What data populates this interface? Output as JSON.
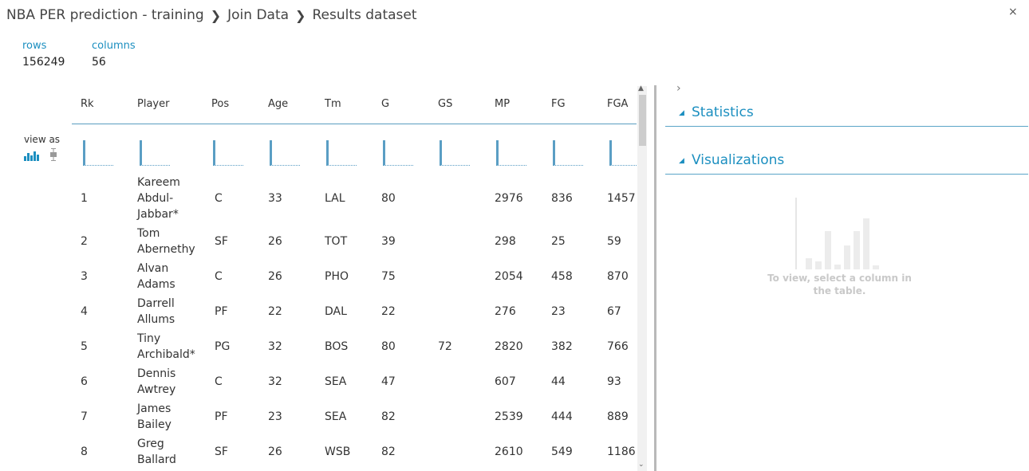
{
  "breadcrumb": {
    "items": [
      "NBA PER prediction - training",
      "Join Data",
      "Results dataset"
    ],
    "separator": "❯"
  },
  "close_label": "×",
  "meta": {
    "rows_label": "rows",
    "rows_value": "156249",
    "columns_label": "columns",
    "columns_value": "56"
  },
  "view_as_label": "view as",
  "table": {
    "columns": [
      "Rk",
      "Player",
      "Pos",
      "Age",
      "Tm",
      "G",
      "GS",
      "MP",
      "FG",
      "FGA"
    ],
    "rows": [
      {
        "Rk": "1",
        "Player": [
          "Kareem",
          "Abdul-",
          "Jabbar*"
        ],
        "Pos": "C",
        "Age": "33",
        "Tm": "LAL",
        "G": "80",
        "GS": "",
        "MP": "2976",
        "FG": "836",
        "FGA": "1457"
      },
      {
        "Rk": "2",
        "Player": [
          "Tom",
          "Abernethy"
        ],
        "Pos": "SF",
        "Age": "26",
        "Tm": "TOT",
        "G": "39",
        "GS": "",
        "MP": "298",
        "FG": "25",
        "FGA": "59"
      },
      {
        "Rk": "3",
        "Player": [
          "Alvan",
          "Adams"
        ],
        "Pos": "C",
        "Age": "26",
        "Tm": "PHO",
        "G": "75",
        "GS": "",
        "MP": "2054",
        "FG": "458",
        "FGA": "870"
      },
      {
        "Rk": "4",
        "Player": [
          "Darrell",
          "Allums"
        ],
        "Pos": "PF",
        "Age": "22",
        "Tm": "DAL",
        "G": "22",
        "GS": "",
        "MP": "276",
        "FG": "23",
        "FGA": "67"
      },
      {
        "Rk": "5",
        "Player": [
          "Tiny",
          "Archibald*"
        ],
        "Pos": "PG",
        "Age": "32",
        "Tm": "BOS",
        "G": "80",
        "GS": "72",
        "MP": "2820",
        "FG": "382",
        "FGA": "766"
      },
      {
        "Rk": "6",
        "Player": [
          "Dennis",
          "Awtrey"
        ],
        "Pos": "C",
        "Age": "32",
        "Tm": "SEA",
        "G": "47",
        "GS": "",
        "MP": "607",
        "FG": "44",
        "FGA": "93"
      },
      {
        "Rk": "7",
        "Player": [
          "James",
          "Bailey"
        ],
        "Pos": "PF",
        "Age": "23",
        "Tm": "SEA",
        "G": "82",
        "GS": "",
        "MP": "2539",
        "FG": "444",
        "FGA": "889"
      },
      {
        "Rk": "8",
        "Player": [
          "Greg",
          "Ballard"
        ],
        "Pos": "SF",
        "Age": "26",
        "Tm": "WSB",
        "G": "82",
        "GS": "",
        "MP": "2610",
        "FG": "549",
        "FGA": "1186"
      }
    ]
  },
  "right_panel": {
    "expand_icon": "chevron-right",
    "sections": [
      {
        "title": "Statistics",
        "expanded": true
      },
      {
        "title": "Visualizations",
        "expanded": true
      }
    ],
    "placeholder_text": "To view, select a column in the table."
  },
  "colors": {
    "accent": "#1c8fc0",
    "divider": "#b9b9b9",
    "placeholder": "#c9c9c9"
  }
}
